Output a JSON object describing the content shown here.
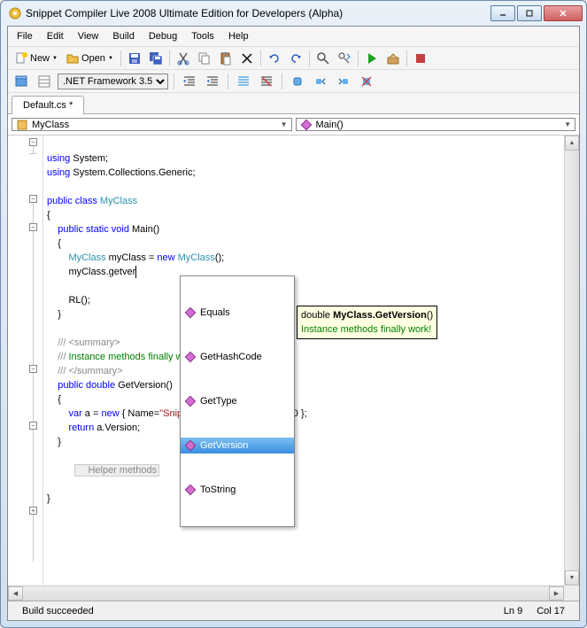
{
  "window": {
    "title": "Snippet Compiler Live 2008 Ultimate Edition for Developers (Alpha)"
  },
  "menu": {
    "file": "File",
    "edit": "Edit",
    "view": "View",
    "build": "Build",
    "debug": "Debug",
    "tools": "Tools",
    "help": "Help"
  },
  "toolbar": {
    "new": "New",
    "open": "Open"
  },
  "framework": {
    "selected": ".NET Framework 3.5"
  },
  "tab": {
    "label": "Default.cs *"
  },
  "nav": {
    "class": "MyClass",
    "method": "Main()"
  },
  "code": {
    "l1a": "using",
    "l1b": " System;",
    "l2a": "using",
    "l2b": " System.Collections.Generic;",
    "l4a": "public",
    "l4b": " class",
    "l4c": " MyClass",
    "l5": "{",
    "l6a": "    public",
    "l6b": " static",
    "l6c": " void",
    "l6d": " Main()",
    "l7": "    {",
    "l8a": "        MyClass",
    "l8b": " myClass = ",
    "l8c": "new",
    "l8d": " MyClass",
    "l8e": "();",
    "l9": "        myClass.getver",
    "l11": "        RL();",
    "l12": "    }",
    "l14a": "    /// ",
    "l14b": "<summary>",
    "l15a": "    ///",
    "l15b": " Instance methods finally work!",
    "l16a": "    /// ",
    "l16b": "</summary>",
    "l17a": "    public",
    "l17b": " double",
    "l17c": " GetVersion()",
    "l18": "    {",
    "l19a": "        var",
    "l19b": " a = ",
    "l19c": "new",
    "l19d": " { Name=",
    "l19e": "\"Snippet Compiler\"",
    "l19f": ", Version=3.0 };",
    "l20a": "        return",
    "l20b": " a.Version;",
    "l21": "    }",
    "l23": "    Helper methods",
    "l25": "}"
  },
  "intellisense": {
    "items": [
      "Equals",
      "GetHashCode",
      "GetType",
      "GetVersion",
      "ToString"
    ],
    "selected": 3
  },
  "tooltip": {
    "ret": "double ",
    "sig": "MyClass.GetVersion",
    "paren": "()",
    "desc": "Instance methods finally work!"
  },
  "status": {
    "msg": "Build succeeded",
    "ln": "Ln 9",
    "col": "Col 17"
  }
}
